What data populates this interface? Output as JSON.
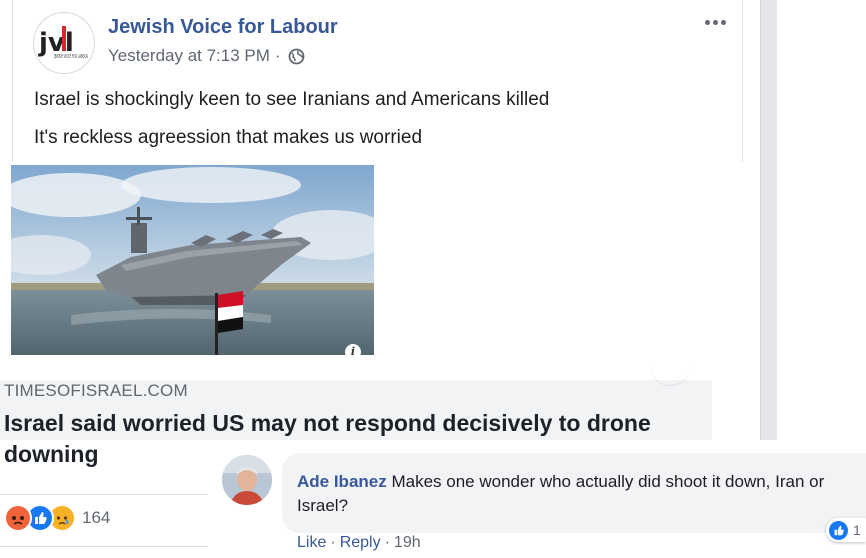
{
  "post": {
    "page_name": "Jewish Voice for Labour",
    "timestamp": "Yesterday at 7:13 PM",
    "meta_separator": "·",
    "avatar_logo": "jvl",
    "avatar_logo_subtext": "JEWISH VOICE FOR LABOUR",
    "text_line_1": "Israel is shockingly keen to see Iranians and Americans killed",
    "text_line_2": "It's reckless agreession that makes us worried",
    "icons": {
      "privacy": "globe-icon",
      "options": "more-options-icon"
    }
  },
  "link_preview": {
    "image": "aircraft-carrier-photo",
    "info_badge": "i",
    "domain": "TIMESOFISRAEL.COM",
    "title": "Israel said worried US may not respond decisively to drone downing"
  },
  "reactions": {
    "types": [
      "angry",
      "like",
      "sad"
    ],
    "count": "164",
    "colors": {
      "angry": "#f0643c",
      "like": "#1877f2",
      "sad": "#f7b125"
    }
  },
  "comment": {
    "author": "Ade Ibanez",
    "text": "Makes one wonder who actually did shoot it down, Iran or Israel?",
    "actions": {
      "like": "Like",
      "reply": "Reply",
      "time": "19h",
      "separator": "·"
    },
    "like_count": "1"
  },
  "colors": {
    "link_blue": "#385898",
    "secondary_text": "#606770",
    "caption_bg": "#f2f3f5"
  }
}
